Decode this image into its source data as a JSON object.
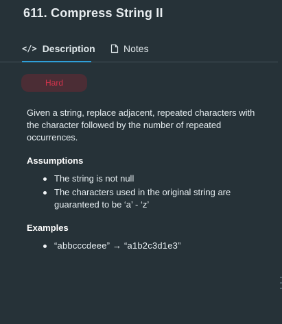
{
  "problem": {
    "title": "611. Compress String II",
    "difficulty": "Hard"
  },
  "tabs": {
    "description": {
      "label": "Description",
      "icon": "code-icon",
      "glyph": "</>"
    },
    "notes": {
      "label": "Notes",
      "icon": "document-icon"
    }
  },
  "content": {
    "description": "Given a string, replace adjacent, repeated characters with the character followed by the number of repeated occurrences.",
    "assumptions_heading": "Assumptions",
    "assumptions": [
      "The string is not null",
      "The characters used in the original string are guaranteed to be ‘a’ - ‘z’"
    ],
    "examples_heading": "Examples",
    "examples": [
      "“abbcccdeee” → “a1b2c3d1e3”"
    ]
  },
  "colors": {
    "background": "#263238",
    "accent": "#2f9fd8",
    "hard_text": "#d3344c",
    "hard_background": "#4b2d35"
  }
}
